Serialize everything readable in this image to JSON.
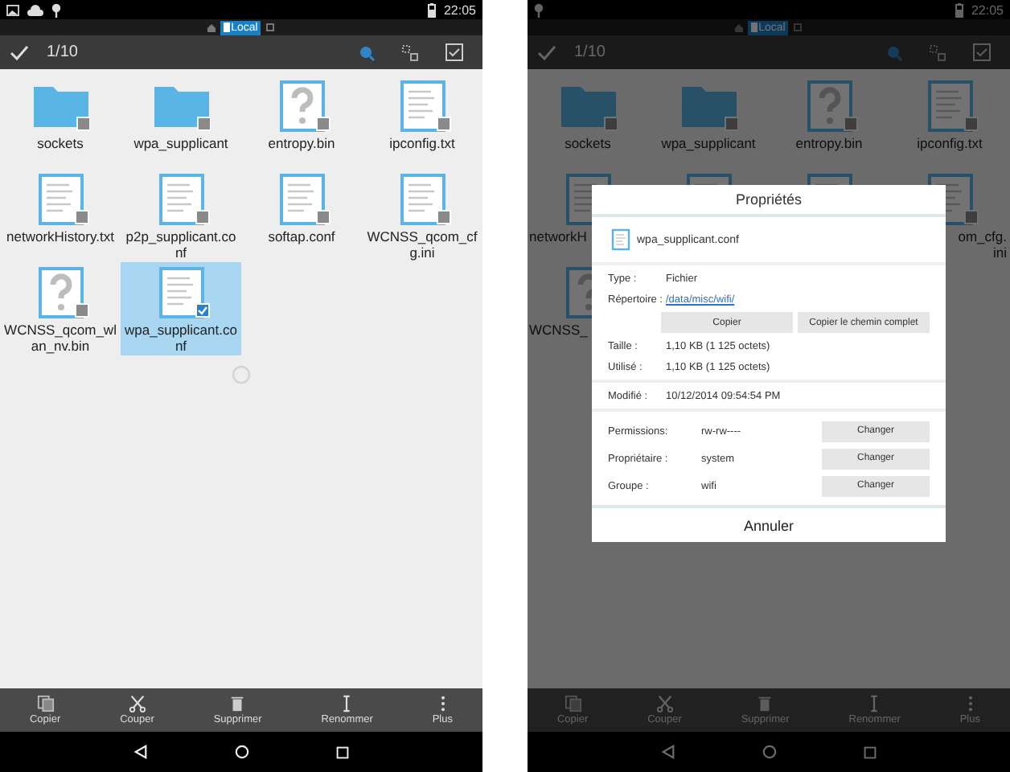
{
  "screens": [
    {
      "dimmed": false,
      "status_icons": [
        {
          "kind": "image"
        },
        {
          "kind": "cloud"
        },
        {
          "kind": "pin"
        }
      ],
      "time": "22:05",
      "location": "Local",
      "count": "1/10",
      "files": [
        {
          "name": "sockets",
          "kind": "folder",
          "selected": false
        },
        {
          "name": "wpa_supplicant",
          "kind": "folder",
          "selected": false
        },
        {
          "name": "entropy.bin",
          "kind": "unknown",
          "selected": false
        },
        {
          "name": "ipconfig.txt",
          "kind": "text",
          "selected": false
        },
        {
          "name": "networkHistory.txt",
          "kind": "text",
          "selected": false
        },
        {
          "name": "p2p_supplicant.conf",
          "kind": "text",
          "selected": false
        },
        {
          "name": "softap.conf",
          "kind": "text",
          "selected": false
        },
        {
          "name": "WCNSS_qcom_cfg.ini",
          "kind": "text",
          "selected": false
        },
        {
          "name": "WCNSS_qcom_wlan_nv.bin",
          "kind": "unknown",
          "selected": false
        },
        {
          "name": "wpa_supplicant.conf",
          "kind": "text",
          "selected": true
        }
      ],
      "loading": true,
      "actions": [
        {
          "label": "Copier",
          "kind": "copy"
        },
        {
          "label": "Couper",
          "kind": "cut"
        },
        {
          "label": "Supprimer",
          "kind": "delete"
        },
        {
          "label": "Renommer",
          "kind": "rename"
        },
        {
          "label": "Plus",
          "kind": "more"
        }
      ]
    },
    {
      "dimmed": true,
      "status_icons": [
        {
          "kind": "pin"
        }
      ],
      "time": "22:05",
      "location": "Local",
      "count": "1/10",
      "files": [
        {
          "name": "sockets",
          "kind": "folder",
          "selected": false
        },
        {
          "name": "wpa_supplicant",
          "kind": "folder",
          "selected": false
        },
        {
          "name": "entropy.bin",
          "kind": "unknown",
          "selected": false
        },
        {
          "name": "ipconfig.txt",
          "kind": "text",
          "selected": false
        },
        {
          "name": "networkH",
          "kind": "text",
          "selected": false,
          "cut": true
        },
        {
          "kind": "text",
          "selected": false
        },
        {
          "kind": "text",
          "selected": false
        },
        {
          "name": "om_cfg.\nini",
          "kind": "text",
          "selected": false,
          "cut": true
        },
        {
          "name": "WCNSS_",
          "kind": "unknown",
          "selected": false,
          "cut": true
        }
      ],
      "loading": false,
      "actions": [
        {
          "label": "Copier",
          "kind": "copy"
        },
        {
          "label": "Couper",
          "kind": "cut"
        },
        {
          "label": "Supprimer",
          "kind": "delete"
        },
        {
          "label": "Renommer",
          "kind": "rename"
        },
        {
          "label": "Plus",
          "kind": "more"
        }
      ],
      "dialog": {
        "title": "Propriétés",
        "file_name": "wpa_supplicant.conf",
        "type_label": "Type :",
        "type_value": "Fichier",
        "dir_label": "Répertoire :",
        "dir_value": "/data/misc/wifi/",
        "copy_buttons": [
          "Copier",
          "Copier le chemin complet"
        ],
        "size_rows": [
          {
            "label": "Taille :",
            "value": "1,10 KB (1 125 octets)"
          },
          {
            "label": "Utilisé :",
            "value": "1,10 KB (1 125 octets)"
          }
        ],
        "modified_label": "Modifié :",
        "modified_value": "10/12/2014 09:54:54 PM",
        "perm_rows": [
          {
            "label": "Permissions:",
            "value": "rw-rw----",
            "button": "Changer"
          },
          {
            "label": "Propriétaire :",
            "value": "system",
            "button": "Changer"
          },
          {
            "label": "Groupe :",
            "value": "wifi",
            "button": "Changer"
          }
        ],
        "cancel": "Annuler"
      }
    }
  ]
}
